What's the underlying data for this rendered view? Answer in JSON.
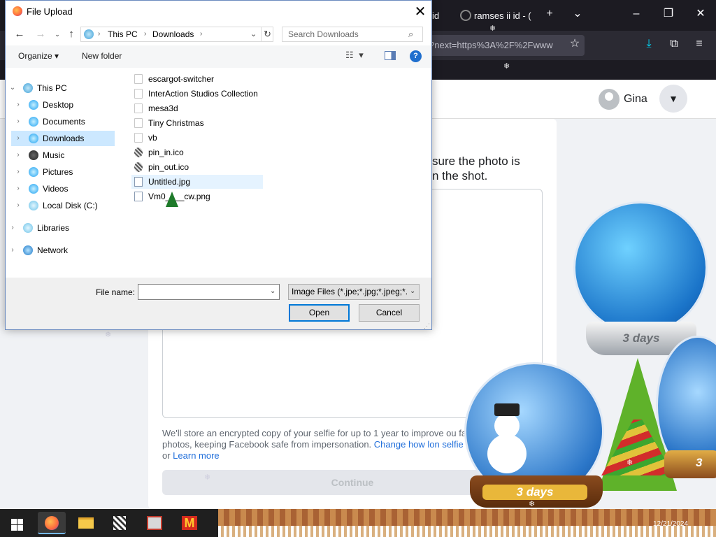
{
  "browser": {
    "tab1_label": "id",
    "tab2_label": "ramses ii id - (",
    "new_tab_icon": "plus-icon",
    "url_text": "?next=https%3A%2F%2Fwww",
    "colors": {
      "tabbar": "#1c1b22",
      "toolbar": "#2b2a33"
    }
  },
  "facebook": {
    "user_name": "Gina",
    "instruction_line1": "sure the photo is",
    "instruction_line2": "n the shot.",
    "note_text": "We'll store an encrypted copy of your selfie for up to 1 year to improve ou fake photos, keeping Facebook safe from impersonation. ",
    "note_link1": "Change how lon selfie for",
    "note_or": " or ",
    "note_link2": "Learn more",
    "continue_label": "Continue",
    "colors": {
      "link": "#216fdb",
      "background": "#f0f2f5"
    }
  },
  "decor": {
    "globe1_label": "3 days",
    "globe2_label": "3 days",
    "globe3_label": "3"
  },
  "dialog": {
    "title": "File Upload",
    "address": {
      "segment1": "This PC",
      "segment2": "Downloads"
    },
    "search_placeholder": "Search Downloads",
    "organize_label": "Organize ▾",
    "new_folder_label": "New folder",
    "nav_tree": [
      {
        "label": "This PC",
        "expanded": true
      },
      {
        "label": "Desktop"
      },
      {
        "label": "Documents"
      },
      {
        "label": "Downloads",
        "selected": true
      },
      {
        "label": "Music"
      },
      {
        "label": "Pictures"
      },
      {
        "label": "Videos"
      },
      {
        "label": "Local Disk (C:)"
      },
      {
        "label": "Libraries"
      },
      {
        "label": "Network"
      }
    ],
    "files": [
      {
        "name": "escargot-switcher",
        "type": "folder"
      },
      {
        "name": "InterAction Studios Collection",
        "type": "folder"
      },
      {
        "name": "mesa3d",
        "type": "folder"
      },
      {
        "name": "Tiny Christmas",
        "type": "folder"
      },
      {
        "name": "vb",
        "type": "folder"
      },
      {
        "name": "pin_in.ico",
        "type": "ico"
      },
      {
        "name": "pin_out.ico",
        "type": "ico"
      },
      {
        "name": "Untitled.jpg",
        "type": "image",
        "hovered": true
      },
      {
        "name": "Vm0____cw.png",
        "type": "image"
      }
    ],
    "file_name_label": "File name:",
    "file_name_value": "",
    "filter_value": "Image Files (*.jpe;*.jpg;*.jpeg;*.",
    "open_label": "Open",
    "cancel_label": "Cancel"
  },
  "taskbar": {
    "clock": "12/21/2024",
    "mcdonalds_glyph": "M"
  }
}
